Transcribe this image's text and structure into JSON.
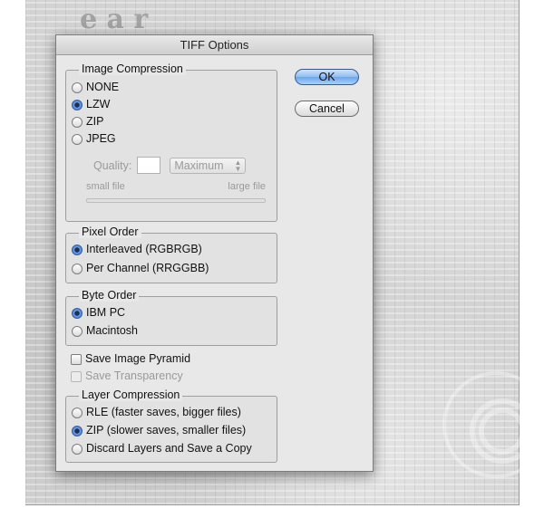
{
  "background": {
    "big_letters": "e  a  r"
  },
  "dialog": {
    "title": "TIFF Options",
    "ok_label": "OK",
    "cancel_label": "Cancel",
    "image_compression": {
      "label": "Image Compression",
      "options": [
        "NONE",
        "LZW",
        "ZIP",
        "JPEG"
      ],
      "selected": "LZW",
      "quality_label": "Quality:",
      "quality_value": "",
      "quality_preset": "Maximum",
      "small_file_label": "small file",
      "large_file_label": "large file"
    },
    "pixel_order": {
      "label": "Pixel Order",
      "options": [
        "Interleaved (RGBRGB)",
        "Per Channel (RRGGBB)"
      ],
      "selected": "Interleaved (RGBRGB)"
    },
    "byte_order": {
      "label": "Byte Order",
      "options": [
        "IBM PC",
        "Macintosh"
      ],
      "selected": "IBM PC"
    },
    "save_image_pyramid": {
      "label": "Save Image Pyramid",
      "checked": false
    },
    "save_transparency": {
      "label": "Save Transparency",
      "checked": false,
      "enabled": false
    },
    "layer_compression": {
      "label": "Layer Compression",
      "options": [
        "RLE (faster saves, bigger files)",
        "ZIP (slower saves, smaller files)",
        "Discard Layers and Save a Copy"
      ],
      "selected": "ZIP (slower saves, smaller files)"
    }
  },
  "colors": {
    "dialog_bg": "#e8e8e8",
    "accent": "#3b76d0",
    "canvas_bg": "#d3d3d3"
  }
}
